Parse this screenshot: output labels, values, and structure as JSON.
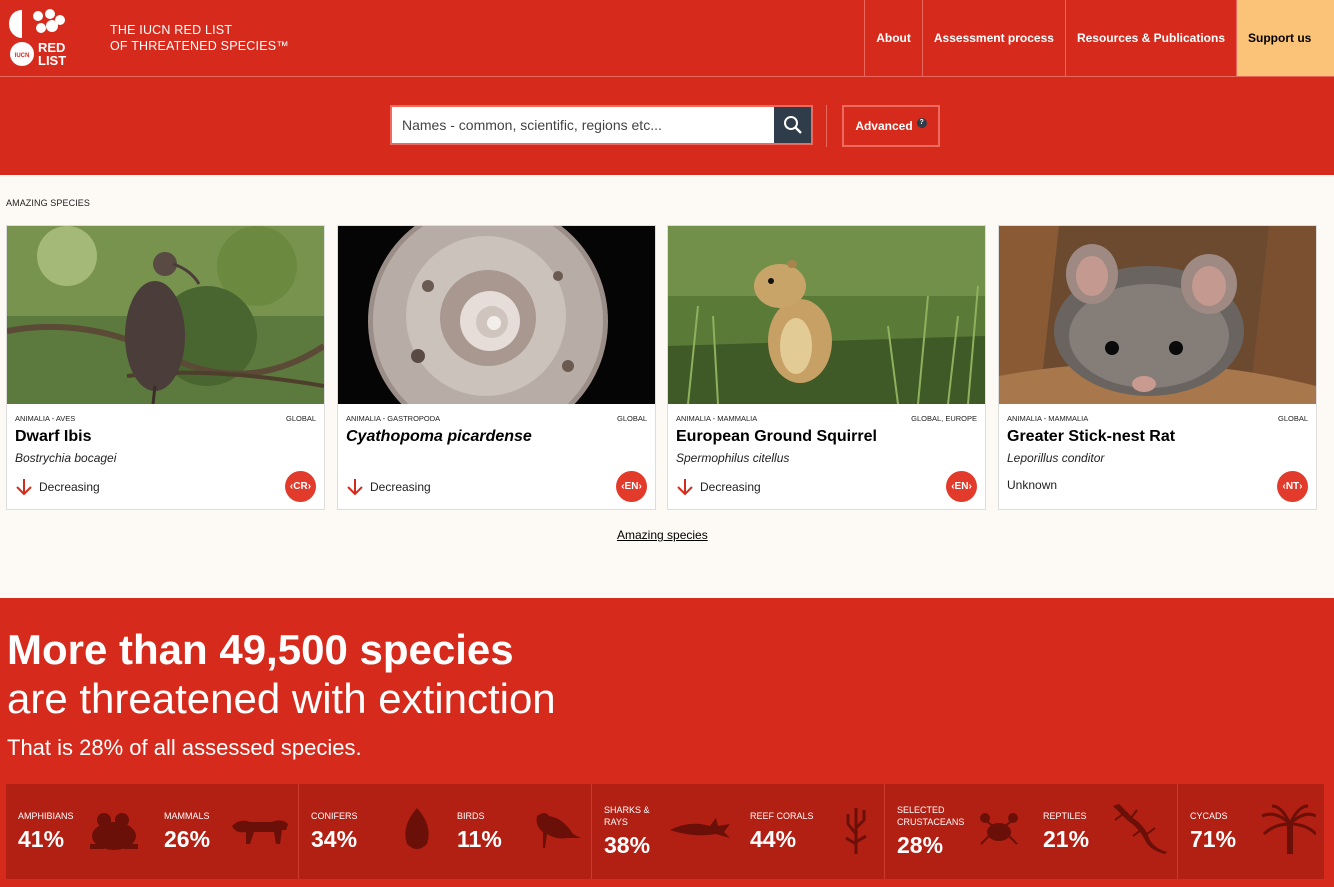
{
  "header": {
    "brand_line1": "THE IUCN RED LIST",
    "brand_line2": "OF THREATENED SPECIES™",
    "logo_text_top": "RED",
    "logo_text_bottom": "LIST",
    "logo_badge": "IUCN",
    "nav": [
      {
        "label": "About"
      },
      {
        "label": "Assessment process"
      },
      {
        "label": "Resources & Publications"
      },
      {
        "label": "Support us"
      }
    ]
  },
  "search": {
    "placeholder": "Names - common, scientific, regions etc...",
    "advanced_label": "Advanced",
    "help_glyph": "?"
  },
  "amazing": {
    "section_label": "AMAZING SPECIES",
    "link_label": "Amazing species",
    "cards": [
      {
        "taxonomy": "ANIMALIA - AVES",
        "scope": "GLOBAL",
        "name": "Dwarf Ibis",
        "scientific": "Bostrychia bocagei",
        "trend": "Decreasing",
        "category": "CR"
      },
      {
        "taxonomy": "ANIMALIA - GASTROPODA",
        "scope": "GLOBAL",
        "name": "Cyathopoma picardense",
        "scientific": "",
        "trend": "Decreasing",
        "category": "EN"
      },
      {
        "taxonomy": "ANIMALIA - MAMMALIA",
        "scope": "GLOBAL, EUROPE",
        "name": "European Ground Squirrel",
        "scientific": "Spermophilus citellus",
        "trend": "Decreasing",
        "category": "EN"
      },
      {
        "taxonomy": "ANIMALIA - MAMMALIA",
        "scope": "GLOBAL",
        "name": "Greater Stick-nest Rat",
        "scientific": "Leporillus conditor",
        "trend": "Unknown",
        "category": "NT"
      }
    ]
  },
  "stats": {
    "headline": "More than 49,500 species",
    "subhead": "are threatened with extinction",
    "subline": "That is 28% of all assessed species.",
    "groups": [
      {
        "name": "AMPHIBIANS",
        "pct": "41%",
        "icon": "frog-icon"
      },
      {
        "name": "MAMMALS",
        "pct": "26%",
        "icon": "big-cat-icon"
      },
      {
        "name": "CONIFERS",
        "pct": "34%",
        "icon": "pinecone-icon"
      },
      {
        "name": "BIRDS",
        "pct": "11%",
        "icon": "bird-icon"
      },
      {
        "name": "SHARKS & RAYS",
        "pct": "38%",
        "icon": "shark-icon"
      },
      {
        "name": "REEF CORALS",
        "pct": "44%",
        "icon": "coral-icon"
      },
      {
        "name": "SELECTED CRUSTACEANS",
        "pct": "28%",
        "icon": "crab-icon"
      },
      {
        "name": "REPTILES",
        "pct": "21%",
        "icon": "lizard-icon"
      },
      {
        "name": "CYCADS",
        "pct": "71%",
        "icon": "cycad-icon"
      }
    ]
  },
  "colors": {
    "brand_red": "#d52a1c",
    "dark_red": "#b21f13",
    "support_bg": "#fbc378",
    "search_btn": "#2e3d49"
  }
}
